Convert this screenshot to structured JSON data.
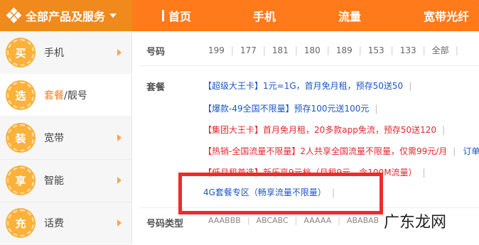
{
  "header": {
    "category_label": "全部产品及服务",
    "nav": [
      "首页",
      "手机",
      "流量",
      "宽带光纤"
    ]
  },
  "sidebar": {
    "items": [
      {
        "badge": "买",
        "label": "手机",
        "active": false
      },
      {
        "badge": "选",
        "label_hl": "套餐",
        "label_rest": "/靓号",
        "active": true
      },
      {
        "badge": "装",
        "label": "宽带",
        "active": false
      },
      {
        "badge": "享",
        "label": "智能",
        "active": false
      },
      {
        "badge": "充",
        "label": "话费",
        "active": false
      }
    ]
  },
  "filters": {
    "number_label": "号码",
    "prefixes": [
      "199",
      "177",
      "181",
      "180",
      "189",
      "153",
      "133",
      "全部"
    ],
    "package_label": "套餐",
    "type_label": "号码类型",
    "types": [
      "AAABBB",
      "ABCABC",
      "AAAAA",
      "ABABAB"
    ]
  },
  "packages": [
    {
      "name": "【超级大王卡】",
      "desc": "1元=1G，首月免月租，预存50送50",
      "style": "blue"
    },
    {
      "name": "【爆款-49全国不限量】",
      "desc": "预存100元送100元",
      "style": "blue"
    },
    {
      "name": "【集团大王卡】",
      "desc": "首月免月租，20多款app免流，预存50送120",
      "style": "red"
    },
    {
      "name": "【热销-全国流量不限量】",
      "desc": "2人共享全国流量不限量，仅需99元/月",
      "style": "red",
      "extra": "订单"
    },
    {
      "name": "【低月租首选】",
      "desc": "新乐享9元档（月租9元，含100M流量）",
      "style": "red"
    },
    {
      "name": "",
      "desc": "4G套餐专区（畅享流量不限量）",
      "style": "blue"
    }
  ],
  "watermark": "广东龙网",
  "colors": {
    "accent": "#ff7a1a",
    "highlight_box": "#ee2b2b",
    "link_blue": "#1d56c4",
    "link_red": "#e0282e"
  }
}
